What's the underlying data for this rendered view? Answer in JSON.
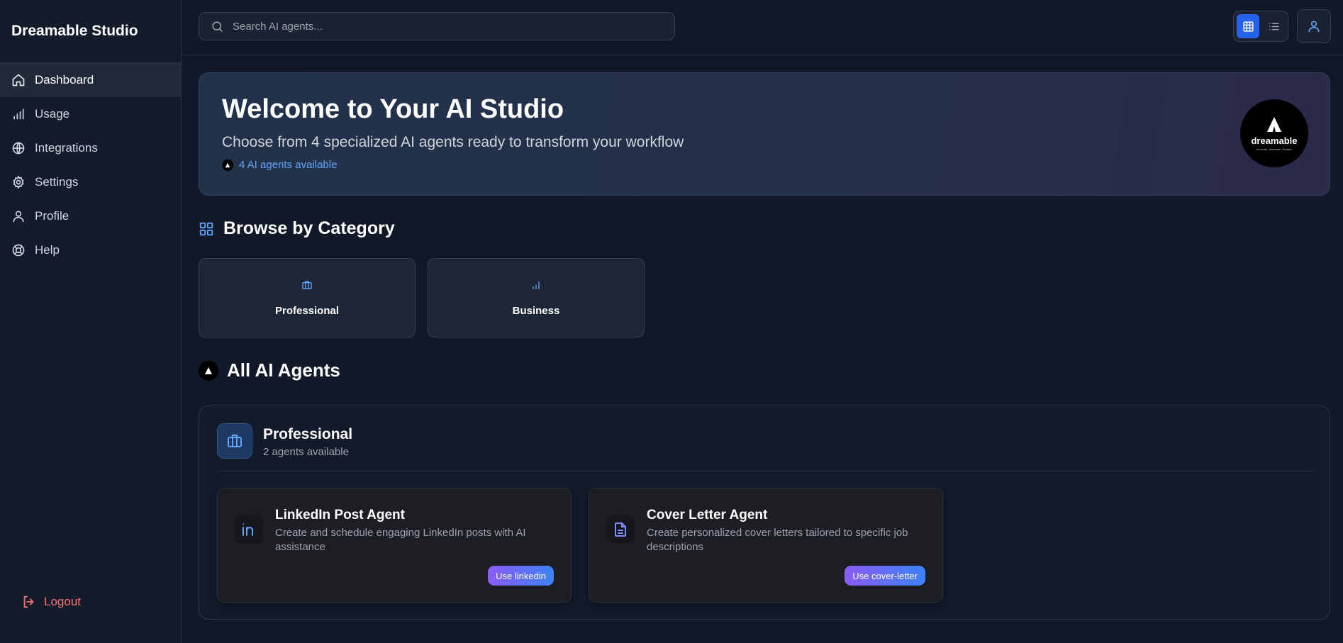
{
  "sidebar": {
    "brand": "Dreamable Studio",
    "items": [
      {
        "label": "Dashboard",
        "icon": "home-icon",
        "active": true
      },
      {
        "label": "Usage",
        "icon": "bar-chart-icon"
      },
      {
        "label": "Integrations",
        "icon": "globe-icon"
      },
      {
        "label": "Settings",
        "icon": "gear-icon"
      },
      {
        "label": "Profile",
        "icon": "user-icon"
      },
      {
        "label": "Help",
        "icon": "lifebuoy-icon"
      }
    ],
    "logout_label": "Logout"
  },
  "search": {
    "placeholder": "Search AI agents..."
  },
  "view_toggle": {
    "active": "grid"
  },
  "hero": {
    "title": "Welcome to Your AI Studio",
    "subtitle": "Choose from 4 specialized AI agents ready to transform your workflow",
    "badge": "4 AI agents available",
    "logo_word": "dreamable",
    "logo_tagline": "Innovate. Automate. Realize"
  },
  "browse": {
    "heading": "Browse by Category",
    "categories": [
      {
        "label": "Professional",
        "icon": "briefcase-icon"
      },
      {
        "label": "Business",
        "icon": "bar-chart-icon"
      }
    ]
  },
  "agents": {
    "heading": "All AI Agents",
    "groups": [
      {
        "title": "Professional",
        "count": "2 agents available",
        "icon": "briefcase-icon",
        "items": [
          {
            "name": "LinkedIn Post Agent",
            "description": "Create and schedule engaging LinkedIn posts with AI assistance",
            "button": "Use linkedin",
            "icon": "linkedin-icon"
          },
          {
            "name": "Cover Letter Agent",
            "description": "Create personalized cover letters tailored to specific job descriptions",
            "button": "Use cover-letter",
            "icon": "document-icon"
          }
        ]
      }
    ]
  },
  "colors": {
    "background": "#111827",
    "sidebar": "#141b2b",
    "accent": "#2563eb",
    "link": "#60a5fa",
    "logout": "#f87171",
    "button_gradient_start": "#8b5cf6",
    "button_gradient_end": "#3b82f6"
  }
}
